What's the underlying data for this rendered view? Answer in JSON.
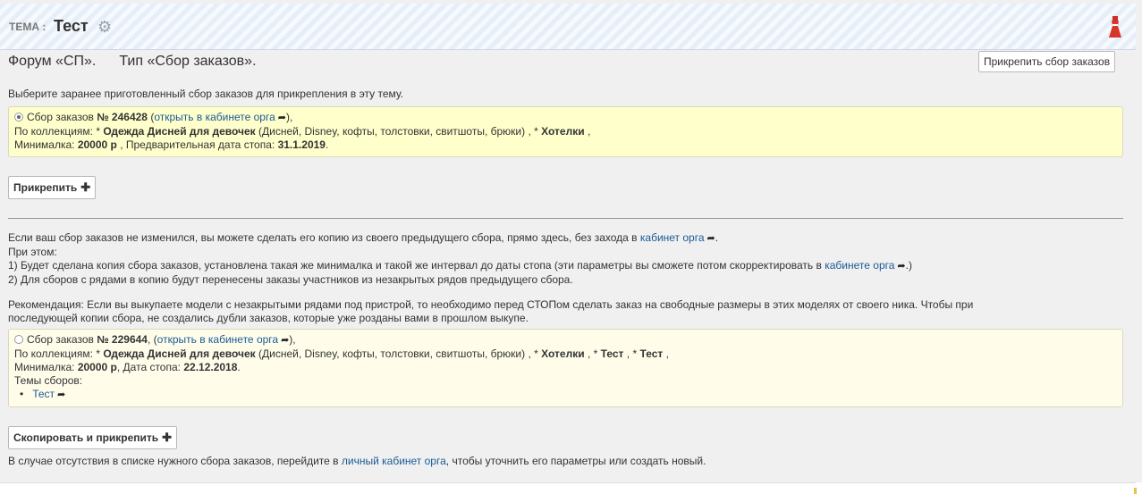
{
  "header": {
    "theme_label": "ТЕМА :",
    "theme_name": "Тест",
    "gear_icon": "gear-icon",
    "dress_icon": "dress-icon"
  },
  "title": {
    "forum": "Форум «СП».",
    "type": "Тип «Сбор заказов»."
  },
  "attach_top_button": "Прикрепить сбор заказов",
  "intro": "Выберите заранее приготовленный сбор заказов для прикрепления в эту тему.",
  "order1": {
    "prefix": "Сбор заказов",
    "number": "№ 246428",
    "sep": " (",
    "link": "открыть в кабинете орга",
    "suffix": "),",
    "collections_label": "По коллекциям: *",
    "collection1": "Одежда Дисней для девочек",
    "collection1_desc": "(Дисней, Disney, кофты, толстовки, свитшоты, брюки) , *",
    "collection2": "Хотелки",
    "collection2_tail": ",",
    "min_label": "Минималка:",
    "min_value": "20000 р",
    "date_label": ", Предварительная дата стопа:",
    "date_value": "31.1.2019",
    "date_tail": "."
  },
  "attach_button": "Прикрепить",
  "copy_section": {
    "line1_text": "Если ваш сбор заказов не изменился, вы можете сделать его копию из своего предыдущего сбора, прямо здесь, без захода в",
    "line1_link": "кабинет орга",
    "line1_tail": ".",
    "line2": "При этом:",
    "line3_text": "1) Будет сделана копия сбора заказов, установлена такая же минималка и такой же интервал до даты стопа (эти параметры вы сможете потом скорректировать в",
    "line3_link": "кабинете орга",
    "line3_tail": ".)",
    "line4": "2) Для сборов с рядами в копию будут перенесены заказы участников из незакрытых рядов предыдущего сбора.",
    "rec_line1": "Рекомендация: Если вы выкупаете модели с незакрытыми рядами под пристрой, то необходимо перед СТОПом сделать заказ на свободные размеры в этих моделях от своего ника. Чтобы при",
    "rec_line2": "последующей копии сбора, не создались дубли заказов, которые уже розданы вами в прошлом выкупе."
  },
  "order2": {
    "prefix": "Сбор заказов",
    "number": "№ 229644",
    "sep": ", (",
    "link": "открыть в кабинете орга",
    "suffix": "),",
    "collections_label": "По коллекциям: *",
    "collection1": "Одежда Дисней для девочек",
    "collection1_desc": "(Дисней, Disney, кофты, толстовки, свитшоты, брюки) , *",
    "collection2": "Хотелки",
    "sep2": ", *",
    "collection3": "Тест",
    "sep3": ", *",
    "collection4": "Тест",
    "collection4_tail": ",",
    "min_label": "Минималка:",
    "min_value": "20000 р",
    "date_label": ", Дата стопа:",
    "date_value": "22.12.2018",
    "date_tail": ".",
    "themes_label": "Темы сборов:",
    "theme_bullet": "•",
    "theme_item": "Тест"
  },
  "copy_button": "Скопировать и прикрепить",
  "footer": {
    "text_before": "В случае отсутствия в списке нужного сбора заказов, перейдите в",
    "link": "личный кабинет орга",
    "text_after": ", чтобы уточнить его параметры или создать новый."
  }
}
